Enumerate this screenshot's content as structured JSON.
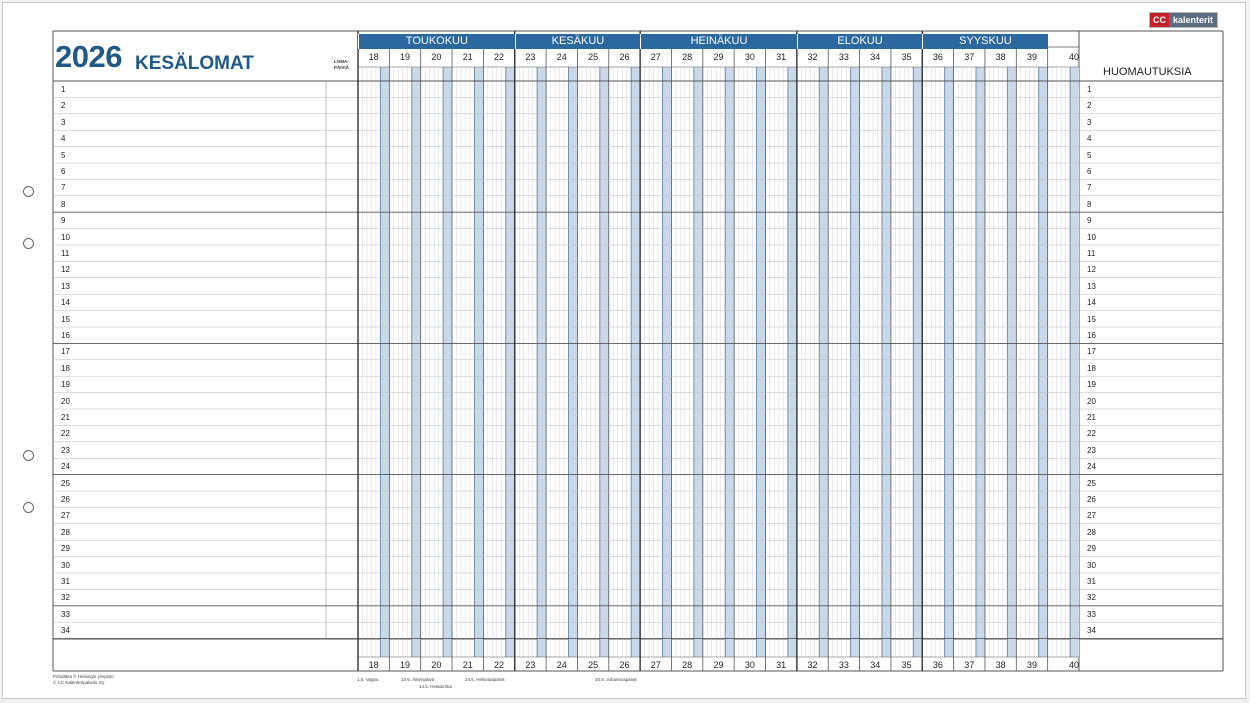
{
  "brand": {
    "cc": "CC",
    "name": "kalenterit"
  },
  "header": {
    "year": "2026",
    "title": "KESÄLOMAT",
    "loma_label": "LOMA-\nPÄIVIÄ",
    "notes_title": "HUOMAUTUKSIA"
  },
  "months": [
    {
      "name": "TOUKOKUU",
      "weeks": [
        "18",
        "19",
        "20",
        "21",
        "22"
      ]
    },
    {
      "name": "KESÄKUU",
      "weeks": [
        "23",
        "24",
        "25",
        "26"
      ]
    },
    {
      "name": "HEINÄKUU",
      "weeks": [
        "27",
        "28",
        "29",
        "30",
        "31"
      ]
    },
    {
      "name": "ELOKUU",
      "weeks": [
        "32",
        "33",
        "34",
        "35"
      ]
    },
    {
      "name": "SYYSKUU",
      "weeks": [
        "36",
        "37",
        "38",
        "39"
      ]
    }
  ],
  "extra_week": "40",
  "rows": [
    "1",
    "2",
    "3",
    "4",
    "5",
    "6",
    "7",
    "8",
    "9",
    "10",
    "11",
    "12",
    "13",
    "14",
    "15",
    "16",
    "17",
    "18",
    "19",
    "20",
    "21",
    "22",
    "23",
    "24",
    "25",
    "26",
    "27",
    "28",
    "29",
    "30",
    "31",
    "32",
    "33",
    "34"
  ],
  "footer": {
    "copyright_1": "Pöhdäkta © Helsingin yliopisto",
    "copyright_2": "© CC Kalenteripalvelu Oy",
    "holidays": [
      "1.5. Vappu",
      "10.5. Äitienpäivä",
      "14.5. Helatorstai",
      "24.5. Helluntaipäivä",
      "20.6. Juhannuspäivä"
    ]
  },
  "colors": {
    "accent": "#2a689f",
    "shade": "#c9d9ea",
    "brand_red": "#c8202b"
  }
}
